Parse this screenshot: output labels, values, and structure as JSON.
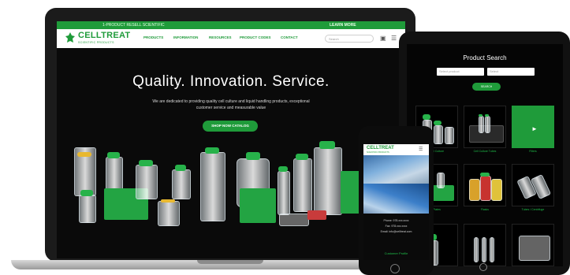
{
  "brand": {
    "name": "CELLTREAT",
    "tagline": "SCIENTIFIC PRODUCTS",
    "accent_color": "#1f9b3a"
  },
  "laptop": {
    "topbar": {
      "left_text": "1-PRODUCT RESELL SCIENTIFIC",
      "right_text": "LEARN MORE"
    },
    "nav": {
      "items": [
        "PRODUCTS",
        "INFORMATION",
        "RESOURCES",
        "PRODUCT CODES",
        "CONTACT"
      ],
      "search_placeholder": "Search"
    },
    "hero": {
      "title": "Quality. Innovation. Service.",
      "subtitle": "We are dedicated to providing quality cell culture and liquid handling products, exceptional customer service and measurable value",
      "button_label": "SHOP NOW CATALOG"
    }
  },
  "tablet": {
    "title": "Product Search",
    "select_1_placeholder": "Select product",
    "select_2_placeholder": "Select",
    "search_button": "SEARCH",
    "tiles": [
      {
        "label": "Cell Culture"
      },
      {
        "label": "Cell Culture Tubes"
      },
      {
        "label": "Filters"
      },
      {
        "label": "Plates"
      },
      {
        "label": "Flasks"
      },
      {
        "label": "Tubes / Centrifuge"
      },
      {
        "label": ""
      },
      {
        "label": ""
      },
      {
        "label": ""
      }
    ]
  },
  "phone": {
    "logo": "CELLTREAT",
    "logo_sub": "SCIENTIFIC PRODUCTS",
    "info_lines": [
      "Phone: 978.xxx.xxxx",
      "Fax: 978.xxx.xxxx",
      "Email: info@celltreat.com"
    ],
    "link_label": "Customer Profile"
  }
}
